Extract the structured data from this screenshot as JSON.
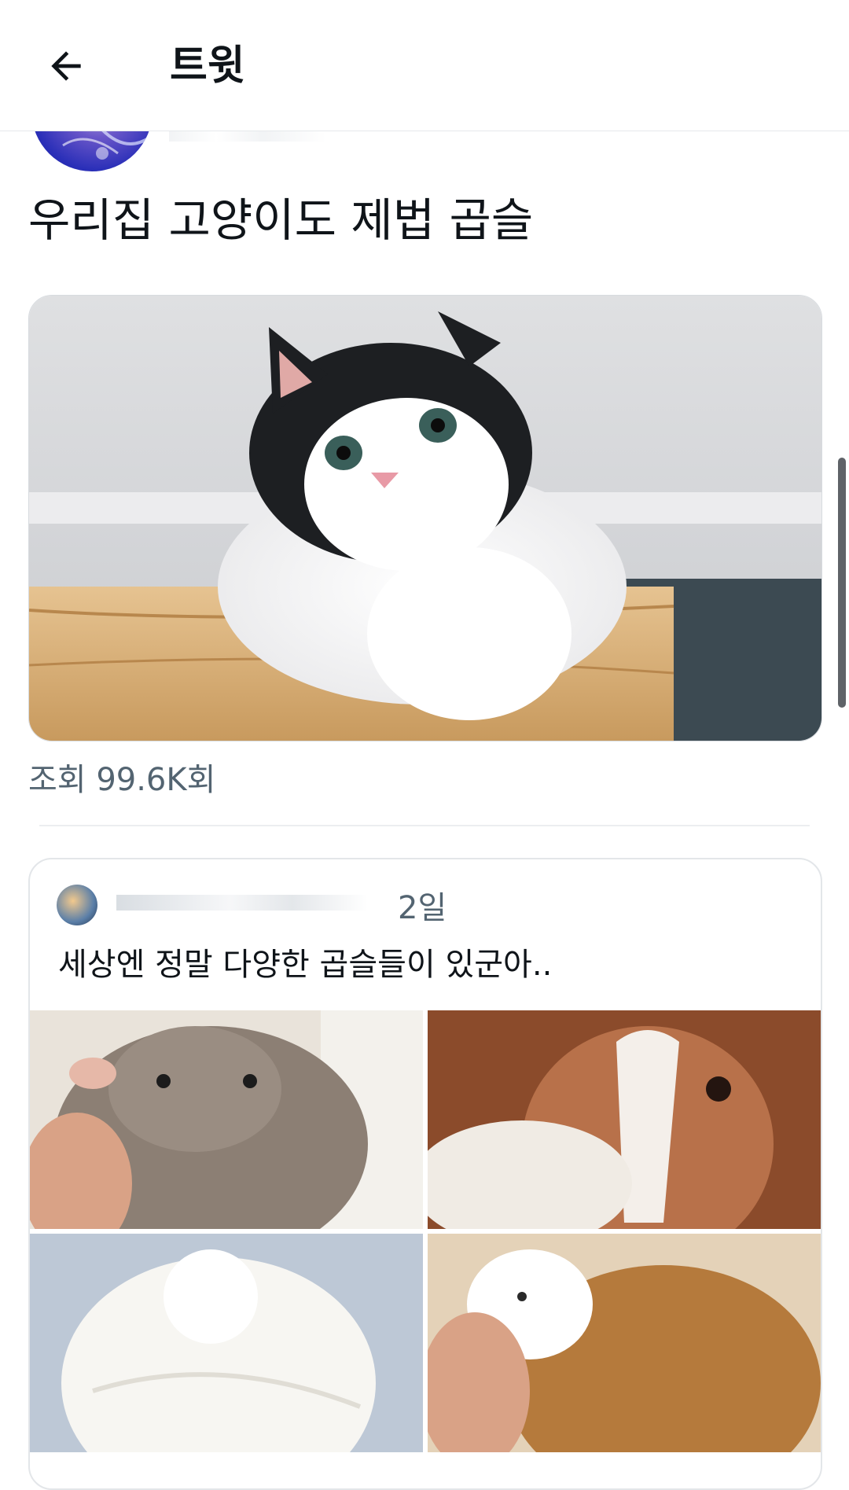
{
  "header": {
    "title": "트윗",
    "back_icon": "arrow-left-icon"
  },
  "tweet": {
    "text": "우리집 고양이도 제법 곱슬",
    "views_label": "조회 99.6K회"
  },
  "quote": {
    "time": "2일",
    "text": "세상엔 정말 다양한 곱슬들이 있군아.."
  },
  "colors": {
    "text_primary": "#0f1419",
    "text_secondary": "#536471",
    "border": "#e3e6e9"
  }
}
